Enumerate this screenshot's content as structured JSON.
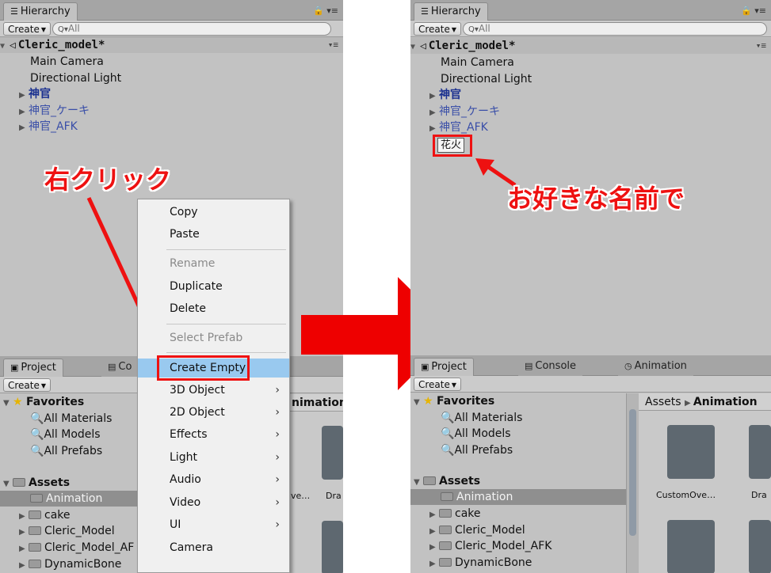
{
  "hierarchy": {
    "tab_label": "Hierarchy",
    "create_label": "Create",
    "search_placeholder": "All",
    "scene_name": "Cleric_model*",
    "items": [
      "Main Camera",
      "Directional Light",
      "神官",
      "神官_ケーキ",
      "神官_AFK"
    ],
    "new_object_name": "花火"
  },
  "project": {
    "tab_project": "Project",
    "tab_console_short": "Co",
    "tab_console": "Console",
    "tab_animation": "Animation",
    "create_label": "Create",
    "favorites_label": "Favorites",
    "favorites": [
      "All Materials",
      "All Models",
      "All Prefabs"
    ],
    "assets_label": "Assets",
    "folders": [
      "Animation",
      "cake",
      "Cleric_Model",
      "Cleric_Model_AFK",
      "DynamicBone"
    ],
    "folders_left_truncated": [
      "Animation",
      "cake",
      "Cleric_Model",
      "Cleric_Model_AF",
      "DynamicBone"
    ],
    "breadcrumb_root": "Assets",
    "breadcrumb_current": "Animation",
    "breadcrumb_current_short": "nimation",
    "assets": [
      "CustomOve…",
      "Dra"
    ],
    "asset_left_short": "ve…",
    "asset_left_2": "Dra"
  },
  "context_menu": {
    "items": [
      {
        "label": "Copy",
        "submenu": false,
        "disabled": false
      },
      {
        "label": "Paste",
        "submenu": false,
        "disabled": false
      },
      {
        "label": "Rename",
        "submenu": false,
        "disabled": true
      },
      {
        "label": "Duplicate",
        "submenu": false,
        "disabled": false
      },
      {
        "label": "Delete",
        "submenu": false,
        "disabled": false
      },
      {
        "label": "Select Prefab",
        "submenu": false,
        "disabled": true
      },
      {
        "label": "Create Empty",
        "submenu": false,
        "disabled": false
      },
      {
        "label": "3D Object",
        "submenu": true,
        "disabled": false
      },
      {
        "label": "2D Object",
        "submenu": true,
        "disabled": false
      },
      {
        "label": "Effects",
        "submenu": true,
        "disabled": false
      },
      {
        "label": "Light",
        "submenu": true,
        "disabled": false
      },
      {
        "label": "Audio",
        "submenu": true,
        "disabled": false
      },
      {
        "label": "Video",
        "submenu": true,
        "disabled": false
      },
      {
        "label": "UI",
        "submenu": true,
        "disabled": false
      },
      {
        "label": "Camera",
        "submenu": false,
        "disabled": false
      }
    ]
  },
  "annotations": {
    "right_click": "右クリック",
    "any_name": "お好きな名前で",
    "color": "#ee1111"
  },
  "colors": {
    "panel": "#c2c2c2",
    "highlight": "#99c9ef",
    "annotation_red": "#ee1111",
    "prefab_blue": "#3a4fa8"
  }
}
